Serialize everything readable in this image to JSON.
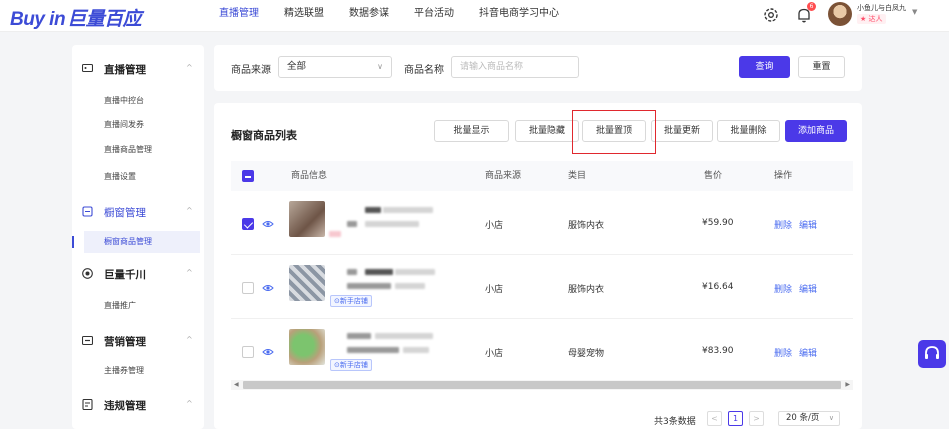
{
  "logo": {
    "en": "Buy in",
    "cn": "巨量百应"
  },
  "nav": [
    "直播管理",
    "精选联盟",
    "数据参谋",
    "平台活动",
    "抖音电商学习中心"
  ],
  "user": {
    "name": "小鱼儿与白凤九",
    "tag": "★ 达人",
    "notifications": "6"
  },
  "sidebar": {
    "groups": [
      {
        "label": "直播管理",
        "icon": "tv-icon",
        "items": [
          "直播中控台",
          "直播间发券",
          "直播商品管理",
          "直播设置"
        ]
      },
      {
        "label": "橱窗管理",
        "icon": "showcase-icon",
        "items": [
          "橱窗商品管理"
        ]
      },
      {
        "label": "巨量千川",
        "icon": "target-icon",
        "items": [
          "直播推广"
        ]
      },
      {
        "label": "营销管理",
        "icon": "marketing-icon",
        "items": [
          "主播券管理"
        ]
      },
      {
        "label": "违规管理",
        "icon": "violation-icon",
        "items": []
      }
    ]
  },
  "filter": {
    "source_label": "商品来源",
    "source_value": "全部",
    "name_label": "商品名称",
    "name_placeholder": "请输入商品名称",
    "query_button": "查询",
    "reset_button": "重置"
  },
  "card": {
    "title": "橱窗商品列表",
    "actions": [
      "批量显示",
      "批量隐藏",
      "批量置顶",
      "批量更新",
      "批量删除"
    ],
    "add_button": "添加商品",
    "columns": [
      "商品信息",
      "商品来源",
      "类目",
      "售价",
      "操作"
    ],
    "rows": [
      {
        "source": "小店",
        "category": "服饰内衣",
        "price": "¥59.90",
        "checked": true,
        "new_shop_tag": ""
      },
      {
        "source": "小店",
        "category": "服饰内衣",
        "price": "¥16.64",
        "checked": false,
        "new_shop_tag": "⊙新手店铺"
      },
      {
        "source": "小店",
        "category": "母婴宠物",
        "price": "¥83.90",
        "checked": false,
        "new_shop_tag": "⊙新手店铺"
      }
    ],
    "row_delete": "删除",
    "row_edit": "编辑"
  },
  "pager": {
    "total": "共3条数据",
    "prev": "<",
    "page": "1",
    "next": ">",
    "size": "20 条/页"
  },
  "colors": {
    "accent": "#4b39e8",
    "highlight_box": "#e0282e",
    "link": "#4b6cf0"
  }
}
